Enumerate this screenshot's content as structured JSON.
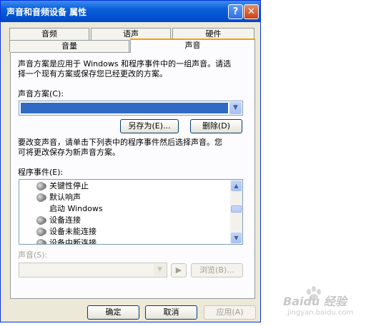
{
  "window": {
    "title": "声音和音频设备 属性",
    "help_glyph": "?",
    "close_glyph": "✕"
  },
  "tabs": {
    "row_back": [
      "音频",
      "语声",
      "硬件"
    ],
    "row_front": [
      "音量",
      "声音"
    ],
    "active": "声音"
  },
  "description": {
    "line1": "声音方案是应用于 Windows 和程序事件中的一组声音。请选",
    "line2": "择一个现有方案或保存您已经更改的方案。"
  },
  "scheme": {
    "label": "声音方案(C):",
    "value": "",
    "save_as_button": "另存为(E)...",
    "delete_button": "删除(D)"
  },
  "instructions": {
    "line1": "要改变声音，请单击下列表中的程序事件然后选择声音。您",
    "line2": "可将更改保存为新声音方案。"
  },
  "events": {
    "label": "程序事件(E):",
    "items": [
      {
        "text": "关键性停止",
        "icon": "speaker-icon"
      },
      {
        "text": "默认响声",
        "icon": "speaker-icon"
      },
      {
        "text": "启动 Windows",
        "icon": ""
      },
      {
        "text": "设备连接",
        "icon": "speaker-icon"
      },
      {
        "text": "设备未能连接",
        "icon": "speaker-icon"
      },
      {
        "text": "设备中断连接",
        "icon": "speaker-icon"
      }
    ],
    "scroll_up_glyph": "▲",
    "scroll_down_glyph": "▼"
  },
  "sound": {
    "label": "声音(S):",
    "value": "",
    "play_glyph": "▶",
    "browse_button": "浏览(B)..."
  },
  "footer": {
    "ok": "确定",
    "cancel": "取消",
    "apply": "应用(A)"
  },
  "watermark": {
    "text": "Baidu 经验",
    "url": "jingyan.baidu.com"
  },
  "colors": {
    "title_blue": "#0a5fd8",
    "selection": "#316ac5",
    "tab_highlight": "#ff9c00",
    "dialog_bg": "#ece9d8"
  }
}
